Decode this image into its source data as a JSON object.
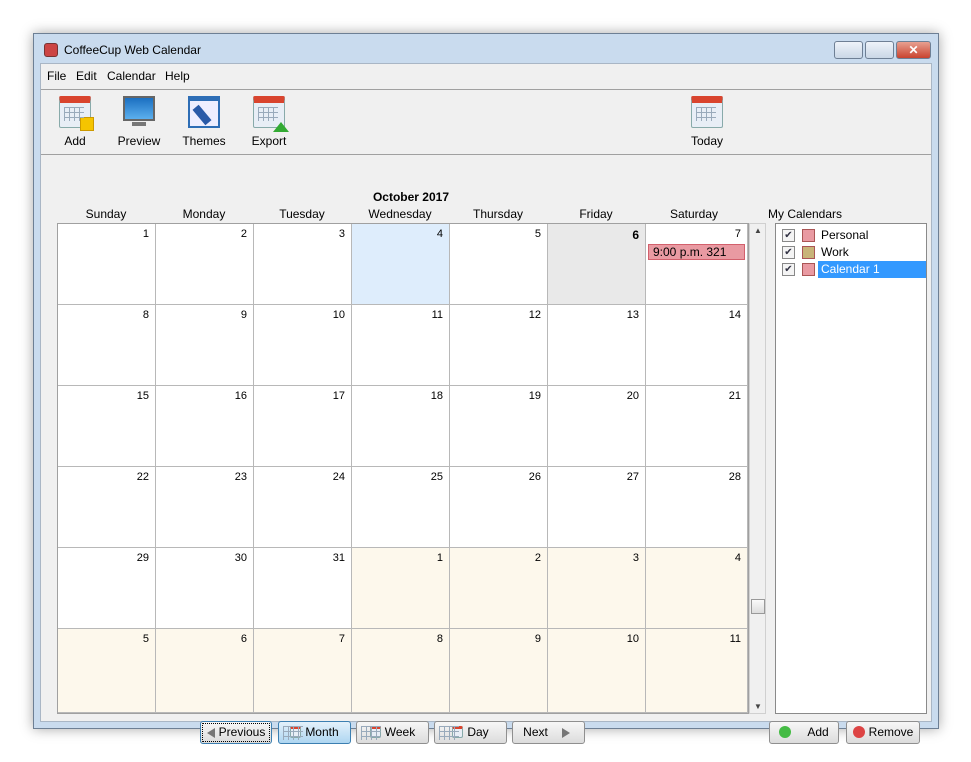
{
  "window": {
    "title": "CoffeeCup Web Calendar",
    "close_glyph": "✕"
  },
  "menu": [
    "File",
    "Edit",
    "Calendar",
    "Help"
  ],
  "toolbar": {
    "add": "Add",
    "preview": "Preview",
    "themes": "Themes",
    "export": "Export",
    "today": "Today"
  },
  "calendar": {
    "month_title": "October 2017",
    "weekdays": [
      "Sunday",
      "Monday",
      "Tuesday",
      "Wednesday",
      "Thursday",
      "Friday",
      "Saturday"
    ],
    "weeks": [
      [
        {
          "d": "1"
        },
        {
          "d": "2"
        },
        {
          "d": "3"
        },
        {
          "d": "4",
          "state": "today"
        },
        {
          "d": "5"
        },
        {
          "d": "6",
          "state": "selected"
        },
        {
          "d": "7",
          "event": "9:00 p.m. 321"
        }
      ],
      [
        {
          "d": "8"
        },
        {
          "d": "9"
        },
        {
          "d": "10"
        },
        {
          "d": "11"
        },
        {
          "d": "12"
        },
        {
          "d": "13"
        },
        {
          "d": "14"
        }
      ],
      [
        {
          "d": "15"
        },
        {
          "d": "16"
        },
        {
          "d": "17"
        },
        {
          "d": "18"
        },
        {
          "d": "19"
        },
        {
          "d": "20"
        },
        {
          "d": "21"
        }
      ],
      [
        {
          "d": "22"
        },
        {
          "d": "23"
        },
        {
          "d": "24"
        },
        {
          "d": "25"
        },
        {
          "d": "26"
        },
        {
          "d": "27"
        },
        {
          "d": "28"
        }
      ],
      [
        {
          "d": "29"
        },
        {
          "d": "30"
        },
        {
          "d": "31"
        },
        {
          "d": "1",
          "state": "other"
        },
        {
          "d": "2",
          "state": "other"
        },
        {
          "d": "3",
          "state": "other"
        },
        {
          "d": "4",
          "state": "other"
        }
      ],
      [
        {
          "d": "5",
          "state": "other"
        },
        {
          "d": "6",
          "state": "other"
        },
        {
          "d": "7",
          "state": "other"
        },
        {
          "d": "8",
          "state": "other"
        },
        {
          "d": "9",
          "state": "other"
        },
        {
          "d": "10",
          "state": "other"
        },
        {
          "d": "11",
          "state": "other"
        }
      ]
    ]
  },
  "my_calendars": {
    "label": "My Calendars",
    "items": [
      {
        "name": "Personal",
        "checked": true,
        "color": "#e99aa2"
      },
      {
        "name": "Work",
        "checked": true,
        "color": "#c8b478"
      },
      {
        "name": "Calendar 1",
        "checked": true,
        "color": "#e99aa2",
        "selected": true
      }
    ],
    "add": "Add",
    "remove": "Remove"
  },
  "nav": {
    "previous": "Previous",
    "month": "Month",
    "week": "Week",
    "day": "Day",
    "next": "Next",
    "active_view": "Month"
  }
}
